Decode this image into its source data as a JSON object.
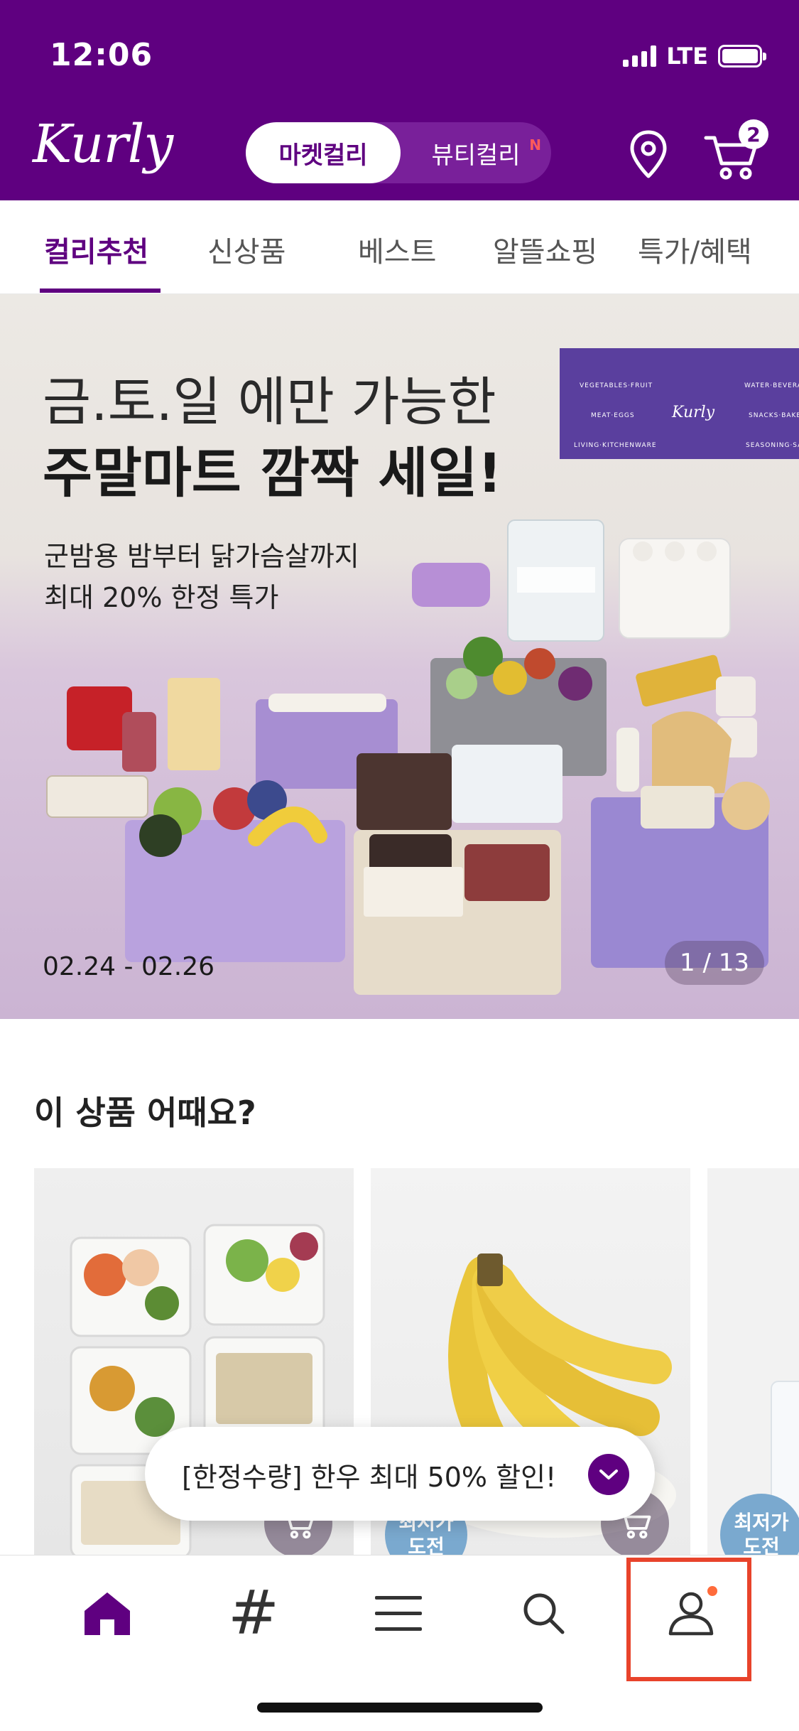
{
  "status_bar": {
    "time": "12:06",
    "network": "LTE"
  },
  "header": {
    "logo": "Kurly",
    "toggle": {
      "active": "마켓컬리",
      "inactive": "뷰티컬리",
      "new_badge": "N"
    },
    "cart_count": "2",
    "brand_color": "#5f0080"
  },
  "tabs": [
    "컬리추천",
    "신상품",
    "베스트",
    "알뜰쇼핑",
    "특가/혜택"
  ],
  "banner": {
    "title_line1": "금.토.일 에만 가능한",
    "title_line2": "주말마트 깜짝 세일!",
    "sub_line1": "군밤용 밤부터 닭가슴살까지",
    "sub_line2": "최대 20% 한정 특가",
    "dates": "02.24 - 02.26",
    "counter": "1 / 13",
    "sign": {
      "l1": "VEGETABLES·FRUIT",
      "l2": "MEAT·EGGS",
      "l3": "LIVING·KITCHENWARE",
      "r1": "WATER·BEVERAG",
      "r2": "SNACKS·BAKER",
      "r3": "SEASONING·SAU",
      "brand": "Kurly"
    }
  },
  "recommend": {
    "title": "이 상품 어때요?",
    "badge": {
      "line1": "최저가",
      "line2": "도전"
    }
  },
  "promo_toast": {
    "text": "[한정수량] 한우 최대 50% 할인!"
  },
  "bottom_nav": {
    "items": [
      "home-icon",
      "hashtag-icon",
      "menu-icon",
      "search-icon",
      "profile-icon"
    ],
    "active": "home-icon",
    "highlighted": "profile-icon",
    "hashtag_glyph": "#"
  }
}
